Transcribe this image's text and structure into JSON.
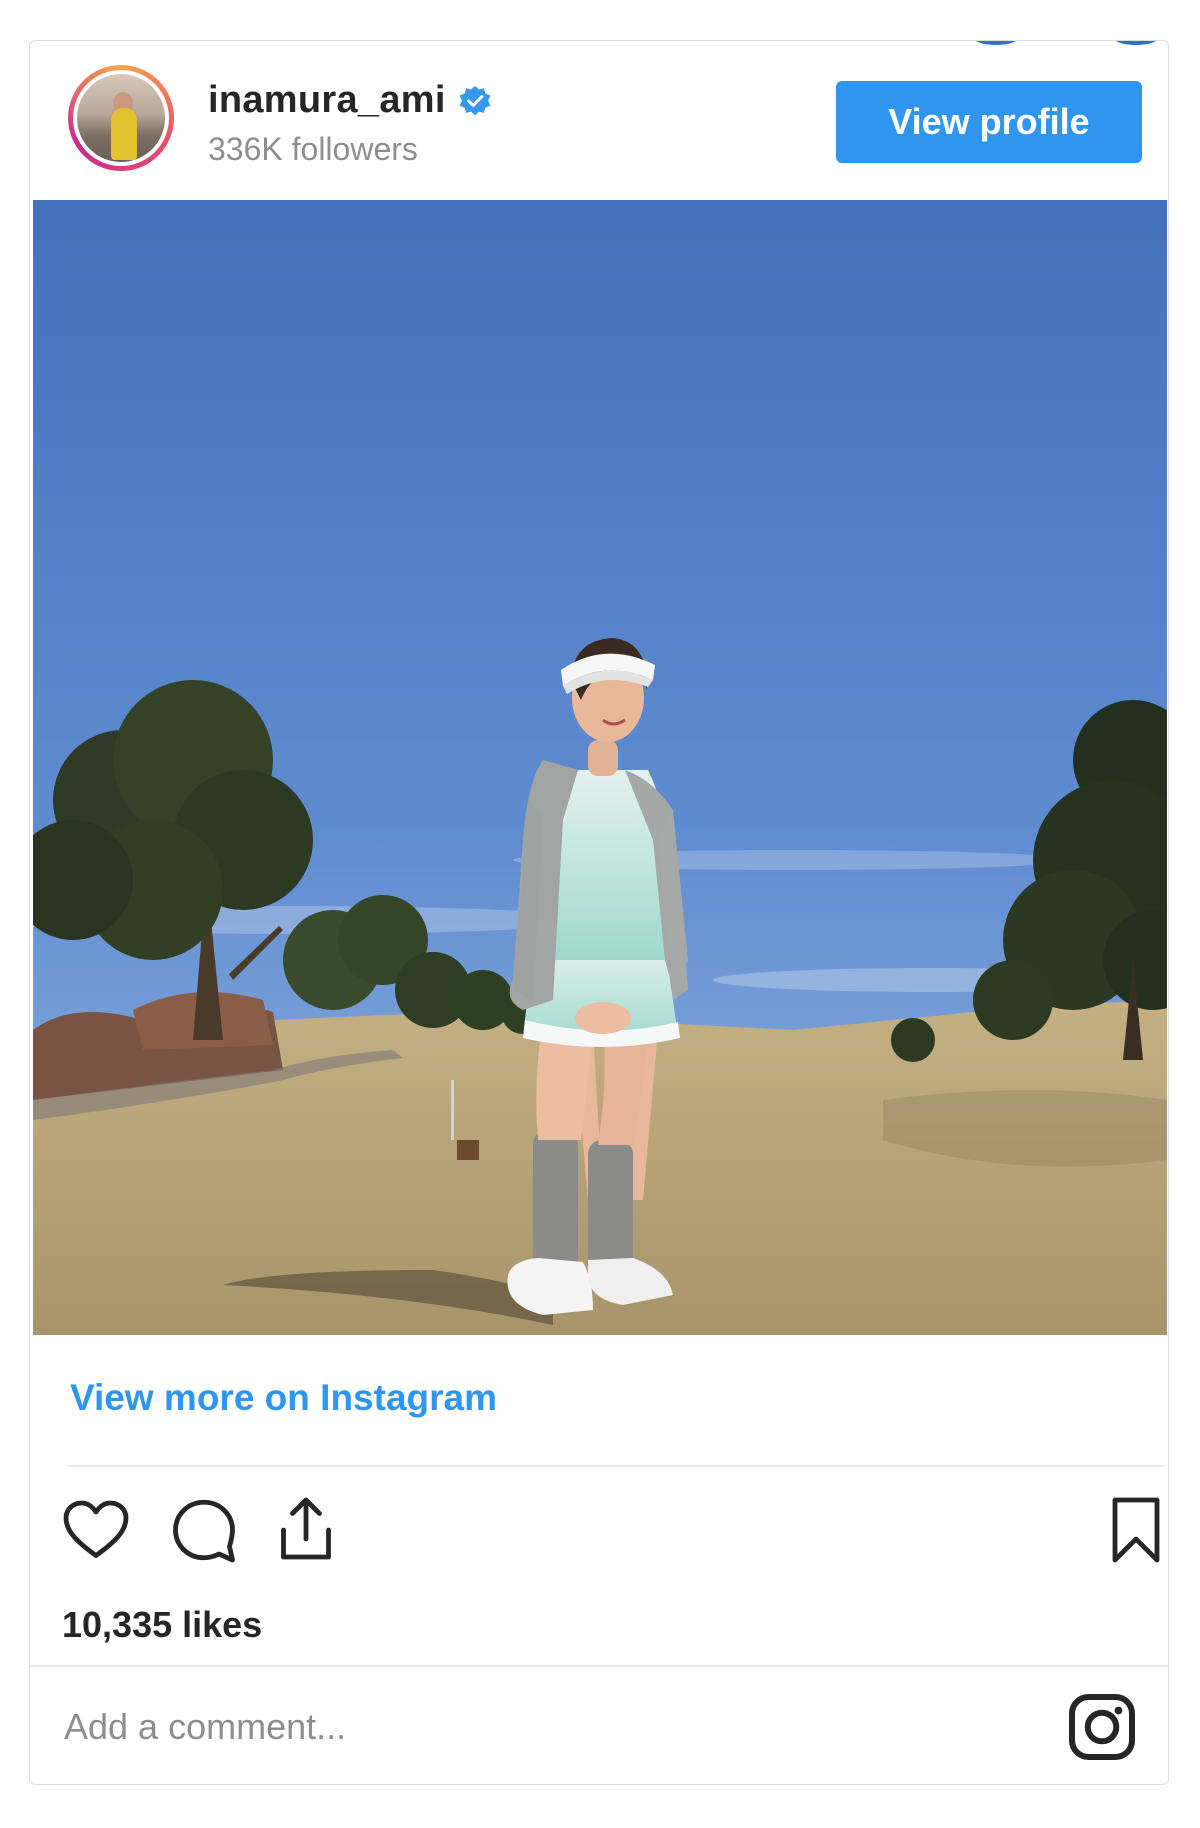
{
  "header": {
    "username": "inamura_ami",
    "followers": "336K followers",
    "verified": true,
    "view_profile_label": "View profile"
  },
  "post": {
    "image_alt": "Golfer in mint skirt, gray vest and knee socks standing on a golf course under blue sky",
    "view_more_label": "View more on Instagram",
    "likes": "10,335 likes",
    "comment_placeholder": "Add a comment..."
  },
  "icons": {
    "verified": "verified-badge-icon",
    "like": "heart-icon",
    "comment": "comment-bubble-icon",
    "share": "share-icon",
    "save": "bookmark-icon",
    "brand": "instagram-icon"
  },
  "colors": {
    "accent": "#2f96f0",
    "text": "#262626",
    "muted": "#8e8e8e",
    "sky_top": "#4a7ac0",
    "sky_bottom": "#8fb2e0",
    "grass": "#b9a57a"
  }
}
